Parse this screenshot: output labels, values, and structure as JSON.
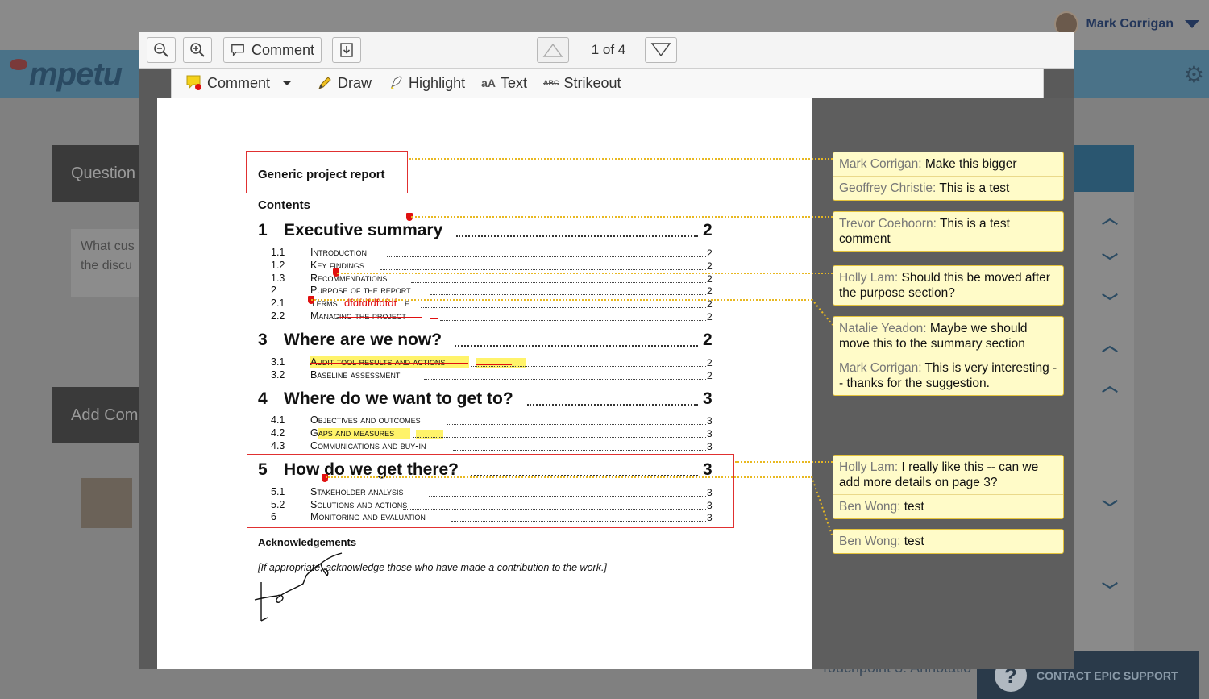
{
  "app": {
    "user_name": "Mark Corrigan",
    "logo_text": "mpetu",
    "question_tab": "Question",
    "question_text_1": "What cus",
    "question_text_2": "the discu",
    "add_comment_tab": "Add Com",
    "support_label": "CONTACT EPIC SUPPORT",
    "touchpoint_text": "Touchpoint 3: Annotatio"
  },
  "toolbar": {
    "comment_label": "Comment",
    "page_indicator": "1 of 4"
  },
  "annotation_tools": {
    "comment": "Comment",
    "draw": "Draw",
    "highlight": "Highlight",
    "text_icon": "aA",
    "text": "Text",
    "strikeout_icon": "ABC",
    "strikeout": "Strikeout"
  },
  "document": {
    "title": "Generic project report",
    "contents_heading": "Contents",
    "sections": [
      {
        "num": "1",
        "title": "Executive summary",
        "page": "2"
      },
      {
        "num": "3",
        "title": "Where are we now?",
        "page": "2"
      },
      {
        "num": "4",
        "title": "Where do we want to get to?",
        "page": "3"
      },
      {
        "num": "5",
        "title": "How do we get there?",
        "page": "3"
      }
    ],
    "subsections": [
      {
        "num": "1.1",
        "title": "Introduction",
        "page": "2"
      },
      {
        "num": "1.2",
        "title": "Key findings",
        "page": "2"
      },
      {
        "num": "1.3",
        "title": "Recommendations",
        "page": "2"
      },
      {
        "num": "2",
        "title": "Purpose of the report",
        "page": "2"
      },
      {
        "num": "2.1",
        "title": "Terms",
        "title_end": "e",
        "page": "2"
      },
      {
        "num": "2.2",
        "title": "Managing the project",
        "page": "2"
      },
      {
        "num": "3.1",
        "title": "Audit tool results and actions",
        "page": "2"
      },
      {
        "num": "3.2",
        "title": "Baseline assessment",
        "page": "2"
      },
      {
        "num": "4.1",
        "title": "Objectives and outcomes",
        "page": "3"
      },
      {
        "num": "4.2",
        "title": "Gaps and measures",
        "page": "3"
      },
      {
        "num": "4.3",
        "title": "Communications and buy-in",
        "page": "3"
      },
      {
        "num": "5.1",
        "title": "Stakeholder analysis",
        "page": "3"
      },
      {
        "num": "5.2",
        "title": "Solutions and actions",
        "page": "3"
      },
      {
        "num": "6",
        "title": "Monitoring and evaluation",
        "page": "3"
      }
    ],
    "inline_text_annotation": "dfdfdfdfdfdf",
    "acknowledgements_heading": "Acknowledgements",
    "acknowledgements_text": "[If appropriate, acknowledge those who have made a contribution to the work.]"
  },
  "comments": [
    {
      "entries": [
        {
          "author": "Mark Corrigan:",
          "text": "Make this bigger"
        },
        {
          "author": "Geoffrey Christie:",
          "text": "This is a test"
        }
      ]
    },
    {
      "entries": [
        {
          "author": "Trevor Coehoorn:",
          "text": "This is a test comment"
        }
      ]
    },
    {
      "entries": [
        {
          "author": "Holly Lam:",
          "text": "Should this be moved after the purpose section?"
        }
      ]
    },
    {
      "entries": [
        {
          "author": "Natalie Yeadon:",
          "text": "Maybe we should move this to the summary section"
        },
        {
          "author": "Mark Corrigan:",
          "text": "This is very interesting -- thanks for the suggestion."
        }
      ]
    },
    {
      "entries": [
        {
          "author": "Holly Lam:",
          "text": "I really like this -- can we add more details on page 3?"
        },
        {
          "author": "Ben Wong:",
          "text": "test"
        }
      ]
    },
    {
      "entries": [
        {
          "author": "Ben Wong:",
          "text": "test"
        }
      ]
    }
  ],
  "colors": {
    "annotation_red": "#e03030",
    "comment_bg": "#fffbc8",
    "comment_border": "#e4c23a",
    "highlight": "#fff36a"
  }
}
